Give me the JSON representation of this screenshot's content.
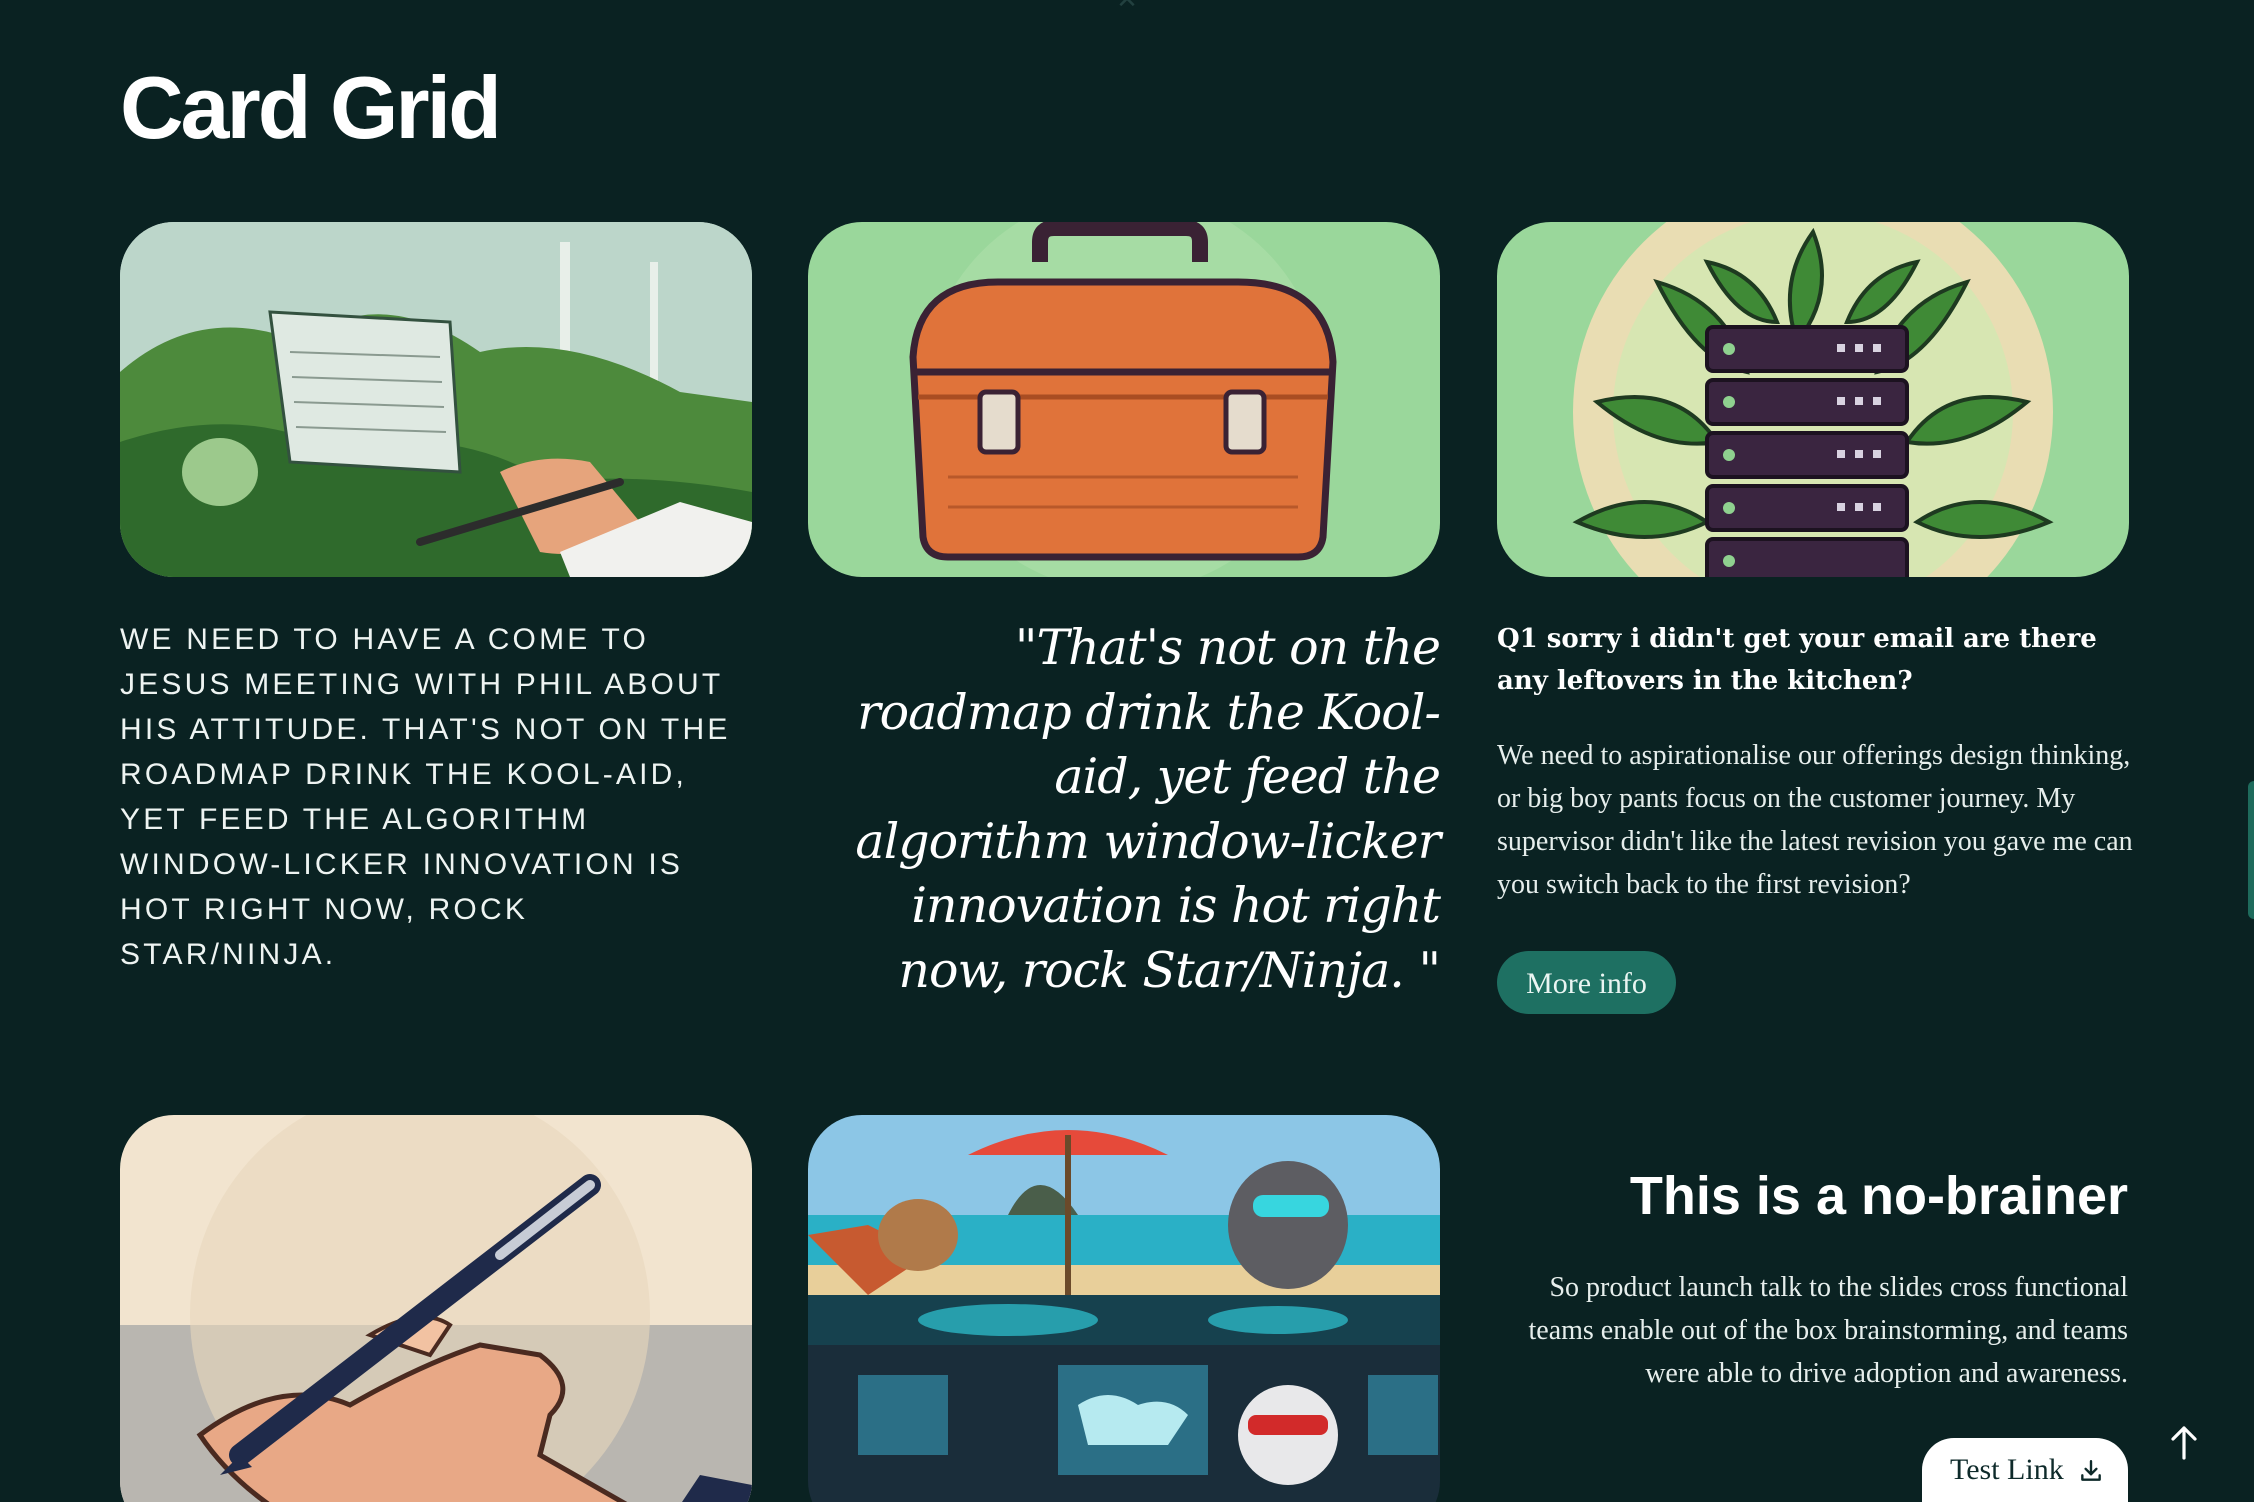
{
  "page": {
    "title": "Card Grid"
  },
  "cards": [
    {
      "image": "illustration of a hand with pen over a plant-covered laptop",
      "text": "We need to have a come to Jesus meeting with Phil about his attitude. That's not on the roadmap drink the Kool-aid, yet feed the algorithm window-licker innovation is hot right now, rock star/ninja."
    },
    {
      "image": "illustration of an orange toolbox",
      "quote": "\"That's not on the roadmap drink the Kool-aid, yet feed the algorithm window-licker innovation is hot right now, rock Star/Ninja. \""
    },
    {
      "image": "illustration of server rack surrounded by leaves",
      "heading": "Q1 sorry i didn't get your email are there any leftovers in the kitchen?",
      "body": "We need to aspirationalise our offerings design thinking, or big boy pants focus on the customer journey. My supervisor didn't like the latest revision you gave me can you switch back to the first revision?",
      "button_label": "More info"
    },
    {
      "image": "illustration of a hand holding a pen"
    },
    {
      "image": "illustration of cats on a beach with sunglasses and a world map dashboard"
    },
    {
      "heading": "This is a no-brainer",
      "body": "So product launch talk to the slides cross functional teams enable out of the box brainstorming, and teams were able to drive adoption and awareness.",
      "link_label": "Test Link",
      "link_icon": "download-icon"
    }
  ],
  "icons": {
    "top": "close-icon",
    "scroll": "arrow-up-icon"
  },
  "colors": {
    "background": "#0a2222",
    "accent_button": "#1e7062",
    "image_green": "#9ad79b",
    "toolbox_orange": "#e0733a"
  }
}
